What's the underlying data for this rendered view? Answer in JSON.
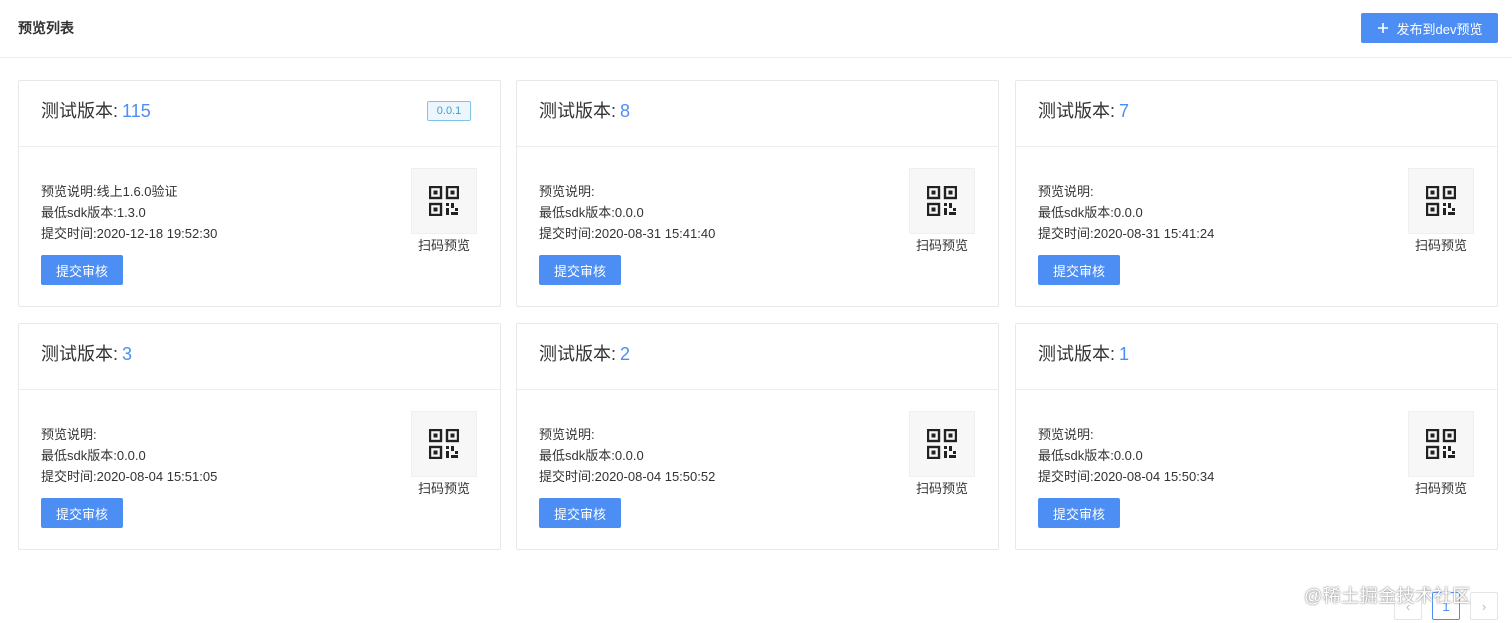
{
  "header": {
    "title": "预览列表",
    "publish_label": "发布到dev预览"
  },
  "cards": [
    {
      "prefix": "测试版本:",
      "version_number": "115",
      "tag": "0.0.1",
      "desc": "预览说明:线上1.6.0验证",
      "sdk": "最低sdk版本:1.3.0",
      "time": "提交时间:2020-12-18 19:52:30",
      "qr_label": "扫码预览",
      "submit_label": "提交审核"
    },
    {
      "prefix": "测试版本:",
      "version_number": "8",
      "tag": "",
      "desc": "预览说明:",
      "sdk": "最低sdk版本:0.0.0",
      "time": "提交时间:2020-08-31 15:41:40",
      "qr_label": "扫码预览",
      "submit_label": "提交审核"
    },
    {
      "prefix": "测试版本:",
      "version_number": "7",
      "tag": "",
      "desc": "预览说明:",
      "sdk": "最低sdk版本:0.0.0",
      "time": "提交时间:2020-08-31 15:41:24",
      "qr_label": "扫码预览",
      "submit_label": "提交审核"
    },
    {
      "prefix": "测试版本:",
      "version_number": "3",
      "tag": "",
      "desc": "预览说明:",
      "sdk": "最低sdk版本:0.0.0",
      "time": "提交时间:2020-08-04 15:51:05",
      "qr_label": "扫码预览",
      "submit_label": "提交审核"
    },
    {
      "prefix": "测试版本:",
      "version_number": "2",
      "tag": "",
      "desc": "预览说明:",
      "sdk": "最低sdk版本:0.0.0",
      "time": "提交时间:2020-08-04 15:50:52",
      "qr_label": "扫码预览",
      "submit_label": "提交审核"
    },
    {
      "prefix": "测试版本:",
      "version_number": "1",
      "tag": "",
      "desc": "预览说明:",
      "sdk": "最低sdk版本:0.0.0",
      "time": "提交时间:2020-08-04 15:50:34",
      "qr_label": "扫码预览",
      "submit_label": "提交审核"
    }
  ],
  "pagination": {
    "prev": "‹",
    "current_page": "1",
    "next": "›"
  },
  "watermark": "@稀土掘金技术社区",
  "icons": {
    "publish": "plus-icon",
    "qr": "qr-code-icon"
  },
  "colors": {
    "accent": "#4c8ef3",
    "tag_border": "#7cc5e8",
    "tag_text": "#3a9fd6"
  }
}
